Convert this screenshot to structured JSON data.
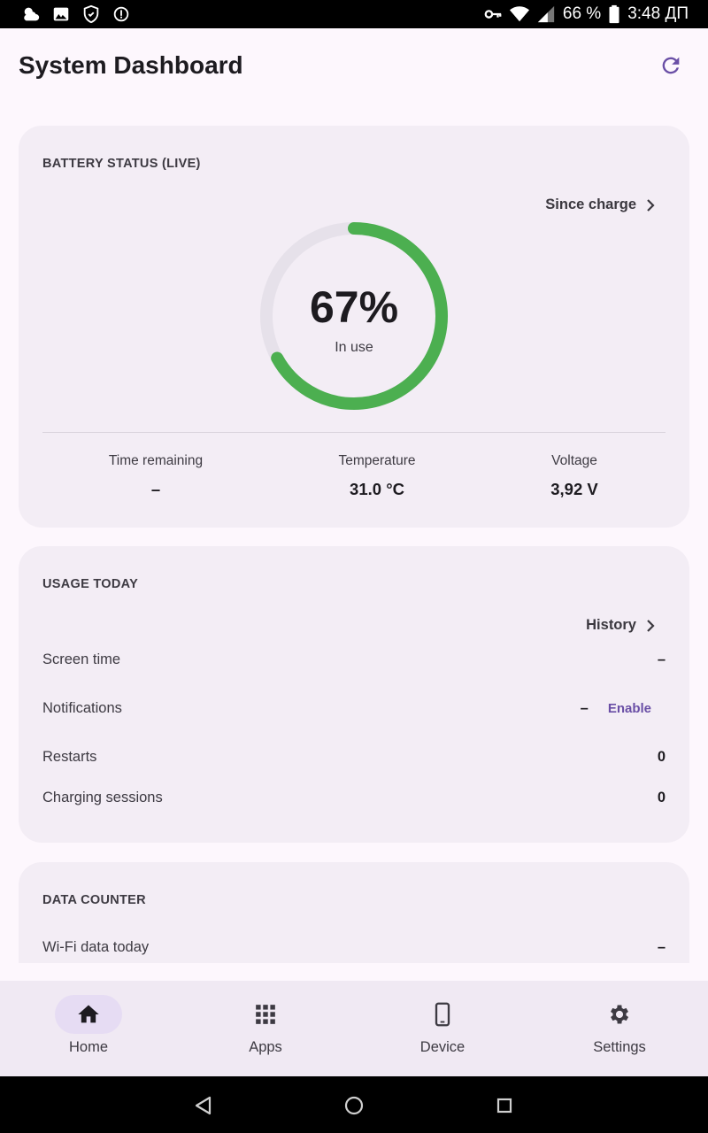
{
  "status_bar": {
    "battery_percent": "66 %",
    "time": "3:48 ДП",
    "left_icons": [
      "weather-icon",
      "image-icon",
      "shield-icon",
      "info-icon"
    ],
    "right_icons": [
      "key-icon",
      "wifi-icon",
      "signal-icon",
      "battery-icon"
    ]
  },
  "header": {
    "title": "System Dashboard",
    "refresh_icon": "refresh-icon"
  },
  "battery_card": {
    "title": "BATTERY STATUS (LIVE)",
    "link_label": "Since charge",
    "level_percent": 67,
    "percent_label": "67%",
    "state_label": "In use",
    "stats": [
      {
        "label": "Time remaining",
        "value": "–"
      },
      {
        "label": "Temperature",
        "value": "31.0 °C"
      },
      {
        "label": "Voltage",
        "value": "3,92 V"
      }
    ],
    "colors": {
      "progress": "#4caf50",
      "track": "#e6e1ea"
    }
  },
  "usage_card": {
    "title": "USAGE TODAY",
    "link_label": "History",
    "rows": [
      {
        "label": "Screen time",
        "value": "–"
      },
      {
        "label": "Notifications",
        "value": "–",
        "action": "Enable"
      },
      {
        "label": "Restarts",
        "value": "0"
      },
      {
        "label": "Charging sessions",
        "value": "0"
      }
    ]
  },
  "data_card": {
    "title": "DATA COUNTER",
    "rows": [
      {
        "label": "Wi-Fi data today",
        "value": "–"
      }
    ]
  },
  "bottom_nav": {
    "items": [
      {
        "label": "Home",
        "icon": "home-icon",
        "active": true
      },
      {
        "label": "Apps",
        "icon": "apps-grid-icon",
        "active": false
      },
      {
        "label": "Device",
        "icon": "phone-icon",
        "active": false
      },
      {
        "label": "Settings",
        "icon": "gear-icon",
        "active": false
      }
    ]
  },
  "colors": {
    "accent": "#6a4fa6",
    "background": "#fdf7fd",
    "card": "#f3edf5",
    "nav_active_pill": "#e6dcf3"
  }
}
